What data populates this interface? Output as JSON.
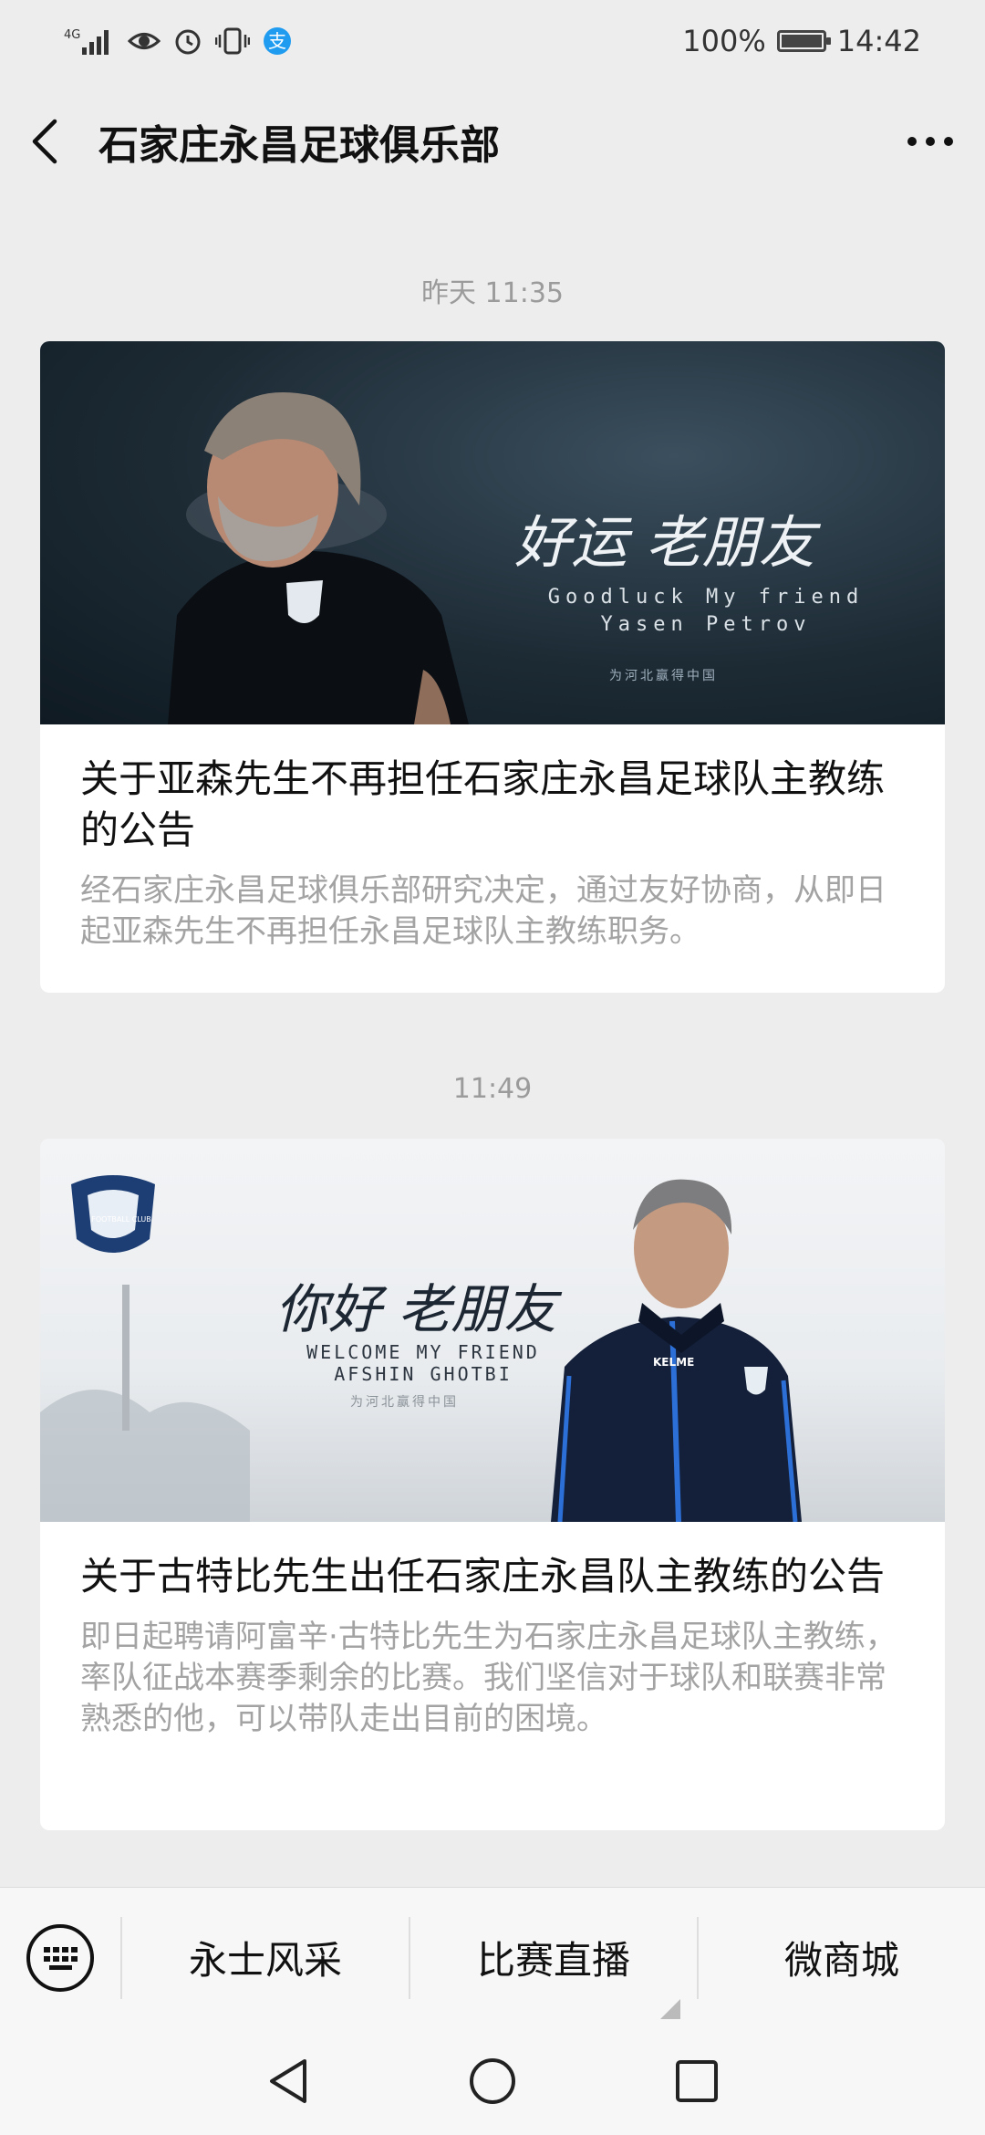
{
  "status_bar": {
    "network": "4G",
    "battery_percent": "100%",
    "time": "14:42",
    "icons": [
      "signal-icon",
      "eye-icon",
      "alarm-icon",
      "vibrate-icon",
      "alipay-icon",
      "battery-icon"
    ]
  },
  "nav": {
    "title": "石家庄永昌足球俱乐部",
    "back_icon": "back-chevron-icon",
    "more_icon": "more-dots-icon"
  },
  "messages": [
    {
      "timestamp": "昨天 11:35",
      "cover": {
        "headline": "好运 老朋友",
        "sub_line1": "Goodluck My friend",
        "sub_line2": "Yasen Petrov",
        "small": "为河北赢得中国"
      },
      "title": "关于亚森先生不再担任石家庄永昌足球队主教练的公告",
      "desc": "经石家庄永昌足球俱乐部研究决定，通过友好协商，从即日起亚森先生不再担任永昌足球队主教练职务。"
    },
    {
      "timestamp": "11:49",
      "cover": {
        "headline": "你好 老朋友",
        "sub_line1": "WELCOME MY FRIEND",
        "sub_line2": "AFSHIN GHOTBI",
        "small": "为河北赢得中国",
        "badge_text": "FOOTBALL CLUB",
        "jacket_text": "KELME"
      },
      "title": "关于古特比先生出任石家庄永昌队主教练的公告",
      "desc": "即日起聘请阿富辛·古特比先生为石家庄永昌足球队主教练，率队征战本赛季剩余的比赛。我们坚信对于球队和联赛非常熟悉的他，可以带队走出目前的困境。"
    }
  ],
  "menu": {
    "items": [
      "永士风采",
      "比赛直播",
      "微商城"
    ]
  },
  "system_nav": [
    "back-triangle-icon",
    "home-circle-icon",
    "recents-square-icon"
  ]
}
